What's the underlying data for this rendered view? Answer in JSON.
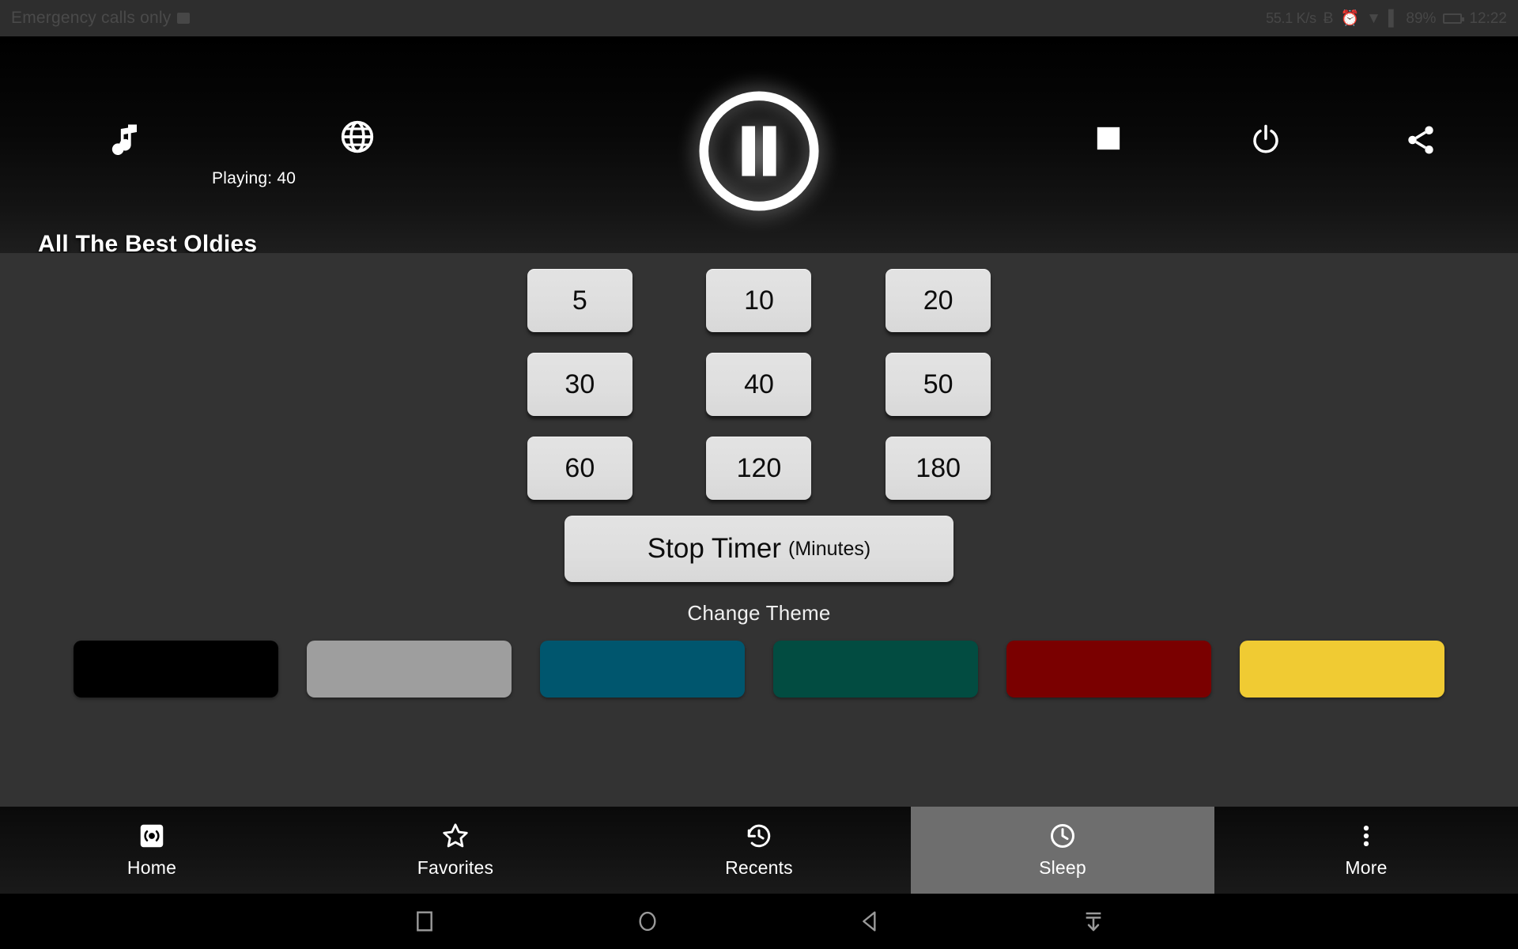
{
  "status_bar": {
    "carrier": "Emergency calls only",
    "network_speed": "55.1 K/s",
    "battery_percent": "89%",
    "clock": "12:22",
    "icons": [
      "signal-icon",
      "bluetooth-icon",
      "alarm-icon",
      "wifi-icon",
      "sim-icon",
      "battery-icon"
    ]
  },
  "player": {
    "music_icon": "music-note-icon",
    "globe_icon": "globe-icon",
    "play_pause_icon": "pause-icon",
    "stop_icon": "stop-square-icon",
    "power_icon": "power-icon",
    "share_icon": "share-icon",
    "playing_label": "Playing: 40",
    "station_title": "All The Best Oldies"
  },
  "sleep": {
    "timer_values": [
      "5",
      "10",
      "20",
      "30",
      "40",
      "50",
      "60",
      "120",
      "180"
    ],
    "stop_timer_main": "Stop Timer",
    "stop_timer_sub": "(Minutes)",
    "change_theme_label": "Change Theme",
    "themes": [
      {
        "name": "black",
        "color": "#000000"
      },
      {
        "name": "gray",
        "color": "#9e9e9e"
      },
      {
        "name": "blue",
        "color": "#00566e"
      },
      {
        "name": "green",
        "color": "#024c41"
      },
      {
        "name": "red",
        "color": "#7a0000"
      },
      {
        "name": "yellow",
        "color": "#f0cb33"
      }
    ]
  },
  "bottom_nav": {
    "items": [
      {
        "label": "Home",
        "icon": "radio-broadcast-icon",
        "active": false
      },
      {
        "label": "Favorites",
        "icon": "star-icon",
        "active": false
      },
      {
        "label": "Recents",
        "icon": "history-icon",
        "active": false
      },
      {
        "label": "Sleep",
        "icon": "clock-icon",
        "active": true
      },
      {
        "label": "More",
        "icon": "overflow-dots-icon",
        "active": false
      }
    ],
    "active_highlight": "#6e6e6e"
  },
  "system_nav": {
    "buttons": [
      "recents-square-icon",
      "home-circle-icon",
      "back-triangle-icon",
      "hide-keyboard-icon"
    ]
  },
  "colors": {
    "content_background": "#333333",
    "toolbar_background": "#000000",
    "button_face": "#dedede"
  }
}
